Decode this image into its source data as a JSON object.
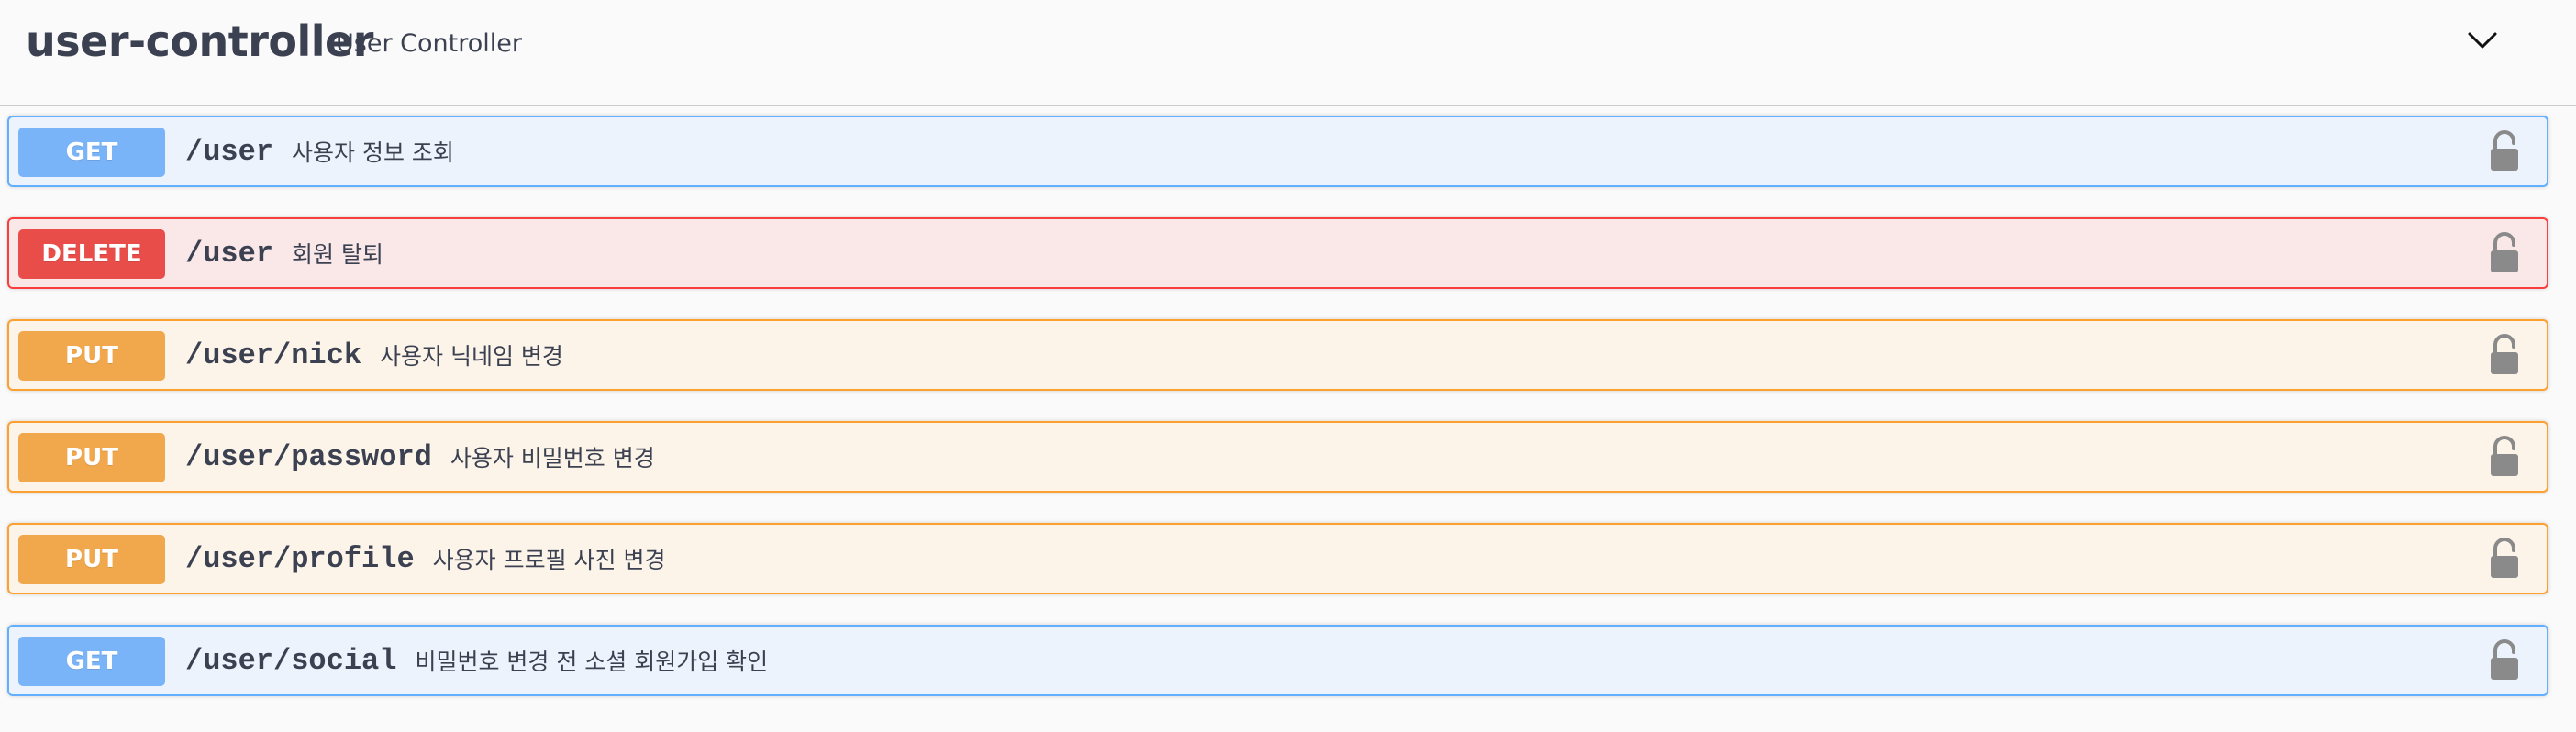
{
  "tag": {
    "name": "user-controller",
    "description": "User Controller",
    "toggle_icon": "chevron-down-icon"
  },
  "colors": {
    "get": "#61affe",
    "delete": "#f93e3e",
    "put": "#fca130"
  },
  "operations": [
    {
      "method": "GET",
      "path": "/user",
      "summary": "사용자 정보 조회",
      "lock_icon": "lock-icon"
    },
    {
      "method": "DELETE",
      "path": "/user",
      "summary": "회원 탈퇴",
      "lock_icon": "lock-icon"
    },
    {
      "method": "PUT",
      "path": "/user/nick",
      "summary": "사용자 닉네임 변경",
      "lock_icon": "lock-icon"
    },
    {
      "method": "PUT",
      "path": "/user/password",
      "summary": "사용자 비밀번호 변경",
      "lock_icon": "lock-icon"
    },
    {
      "method": "PUT",
      "path": "/user/profile",
      "summary": "사용자 프로필 사진 변경",
      "lock_icon": "lock-icon"
    },
    {
      "method": "GET",
      "path": "/user/social",
      "summary": "비밀번호 변경 전 소셜 회원가입 확인",
      "lock_icon": "lock-icon"
    }
  ]
}
